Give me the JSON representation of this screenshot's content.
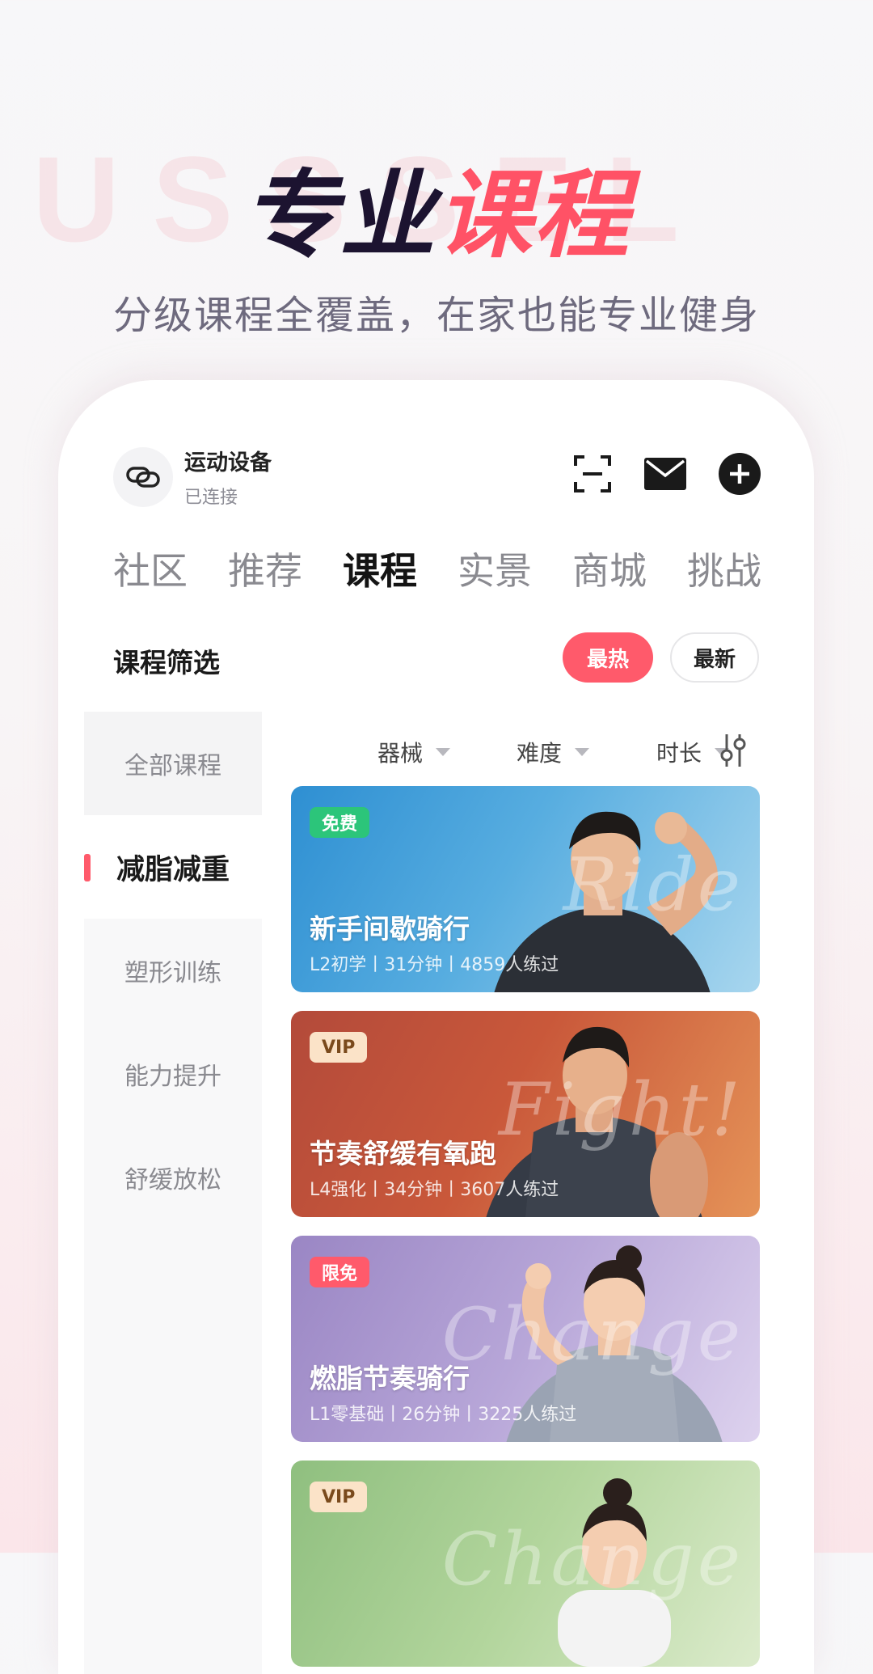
{
  "hero": {
    "bg_text": "USSSEL",
    "title_part1": "专业",
    "title_part2": "课程",
    "subtitle": "分级课程全覆盖，在家也能专业健身"
  },
  "device": {
    "name": "运动设备",
    "status": "已连接",
    "icon": "link-icon"
  },
  "header_icons": [
    "scan-icon",
    "mail-icon",
    "add-icon"
  ],
  "tabs": [
    {
      "label": "社区",
      "active": false
    },
    {
      "label": "推荐",
      "active": false
    },
    {
      "label": "课程",
      "active": true
    },
    {
      "label": "实景",
      "active": false
    },
    {
      "label": "商城",
      "active": false
    },
    {
      "label": "挑战",
      "active": false
    }
  ],
  "filter": {
    "title": "课程筛选",
    "sort_hot": "最热",
    "sort_new": "最新",
    "active_sort": "最热"
  },
  "categories": [
    {
      "label": "全部课程",
      "active": false
    },
    {
      "label": "减脂减重",
      "active": true
    },
    {
      "label": "塑形训练",
      "active": false
    },
    {
      "label": "能力提升",
      "active": false
    },
    {
      "label": "舒缓放松",
      "active": false
    }
  ],
  "dropdowns": [
    "器械",
    "难度",
    "时长"
  ],
  "courses": [
    {
      "badge": "免费",
      "title": "新手间歇骑行",
      "meta": "L2初学丨31分钟丨4859人练过",
      "script": "Ride"
    },
    {
      "badge": "VIP",
      "title": "节奏舒缓有氧跑",
      "meta": "L4强化丨34分钟丨3607人练过",
      "script": "Fight!"
    },
    {
      "badge": "限免",
      "title": "燃脂节奏骑行",
      "meta": "L1零基础丨26分钟丨3225人练过",
      "script": "Change"
    },
    {
      "badge": "VIP",
      "title": "",
      "meta": "",
      "script": "Change"
    }
  ],
  "colors": {
    "accent": "#ff5266",
    "dark": "#1c1330"
  }
}
